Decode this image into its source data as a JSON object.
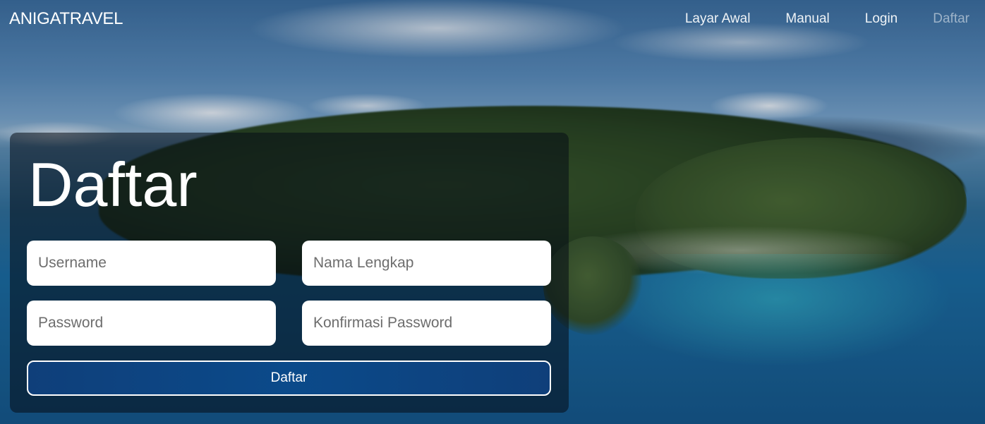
{
  "navbar": {
    "brand": "ANIGATRAVEL",
    "links": [
      {
        "label": "Layar Awal",
        "active": false
      },
      {
        "label": "Manual",
        "active": false
      },
      {
        "label": "Login",
        "active": false
      },
      {
        "label": "Daftar",
        "active": true
      }
    ]
  },
  "form": {
    "title": "Daftar",
    "username_placeholder": "Username",
    "fullname_placeholder": "Nama Lengkap",
    "password_placeholder": "Password",
    "confirm_placeholder": "Konfirmasi Password",
    "submit_label": "Daftar"
  },
  "colors": {
    "button_bg": "#0b4a8a",
    "panel_bg": "rgba(5,12,22,0.55)"
  }
}
